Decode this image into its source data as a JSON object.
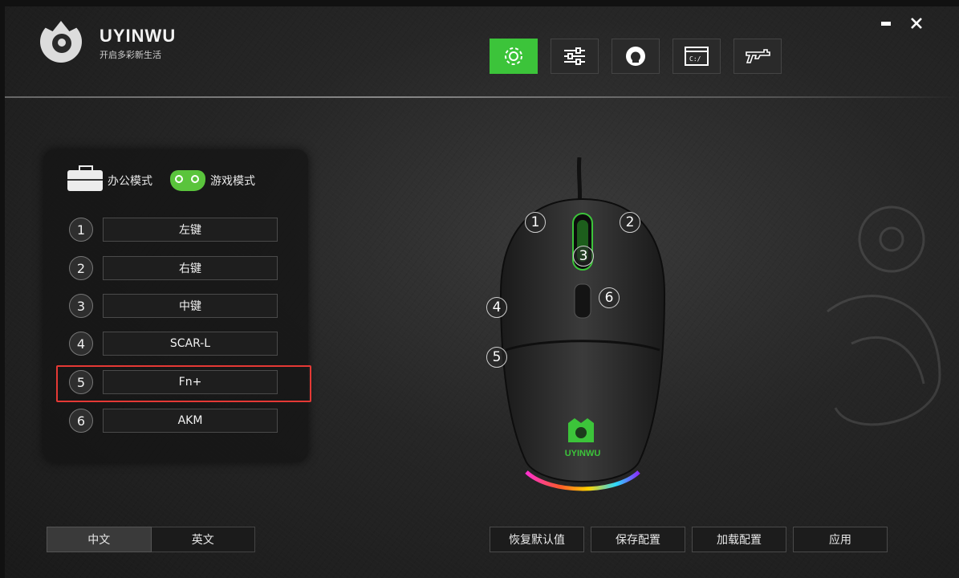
{
  "brand": {
    "name": "UYINWU",
    "tagline": "开启多彩新生活"
  },
  "toolbar": {
    "items": [
      {
        "icon": "gear-icon",
        "active": true
      },
      {
        "icon": "sliders-icon",
        "active": false
      },
      {
        "icon": "lightbulb-icon",
        "active": false
      },
      {
        "icon": "terminal-icon",
        "active": false
      },
      {
        "icon": "gun-icon",
        "active": false
      }
    ],
    "terminal_text": "C:/"
  },
  "modes": {
    "office_label": "办公模式",
    "game_label": "游戏模式"
  },
  "buttons": [
    {
      "num": "1",
      "label": "左键"
    },
    {
      "num": "2",
      "label": "右键"
    },
    {
      "num": "3",
      "label": "中键"
    },
    {
      "num": "4",
      "label": "SCAR-L"
    },
    {
      "num": "5",
      "label": "Fn+"
    },
    {
      "num": "6",
      "label": "AKM"
    }
  ],
  "mouse": {
    "callouts": [
      "1",
      "2",
      "3",
      "4",
      "5",
      "6"
    ],
    "logo_text": "UYINWU"
  },
  "language": {
    "zh_label": "中文",
    "en_label": "英文"
  },
  "actions": {
    "restore_label": "恢复默认值",
    "save_label": "保存配置",
    "load_label": "加载配置",
    "apply_label": "应用"
  },
  "colors": {
    "accent": "#3cc43a",
    "highlight": "#e53935"
  }
}
